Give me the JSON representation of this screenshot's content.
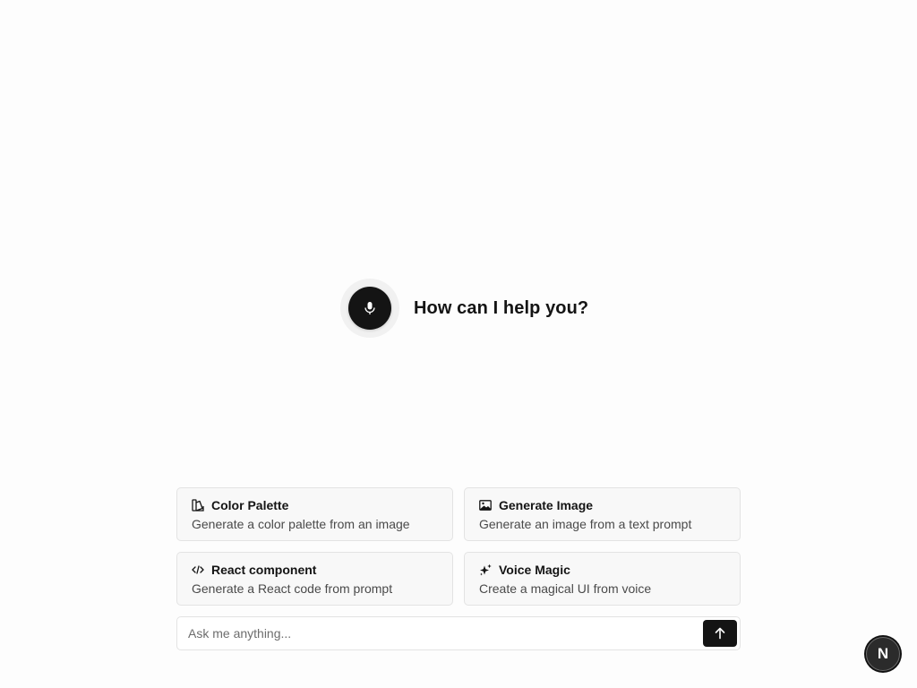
{
  "hero": {
    "title": "How can I help you?",
    "mic_icon": "microphone-icon"
  },
  "suggestions": [
    {
      "icon": "palette-icon",
      "title": "Color Palette",
      "description": "Generate a color palette from an image"
    },
    {
      "icon": "image-icon",
      "title": "Generate Image",
      "description": "Generate an image from a text prompt"
    },
    {
      "icon": "code-icon",
      "title": "React component",
      "description": "Generate a React code from prompt"
    },
    {
      "icon": "sparkles-icon",
      "title": "Voice Magic",
      "description": "Create a magical UI from voice"
    }
  ],
  "prompt": {
    "placeholder": "Ask me anything...",
    "value": "",
    "send_icon": "arrow-up-icon"
  },
  "badge": {
    "letter": "N"
  },
  "colors": {
    "background": "#fdfdfd",
    "accent": "#141414",
    "card_background": "#f8f8f8",
    "border": "#e3e3e3"
  }
}
